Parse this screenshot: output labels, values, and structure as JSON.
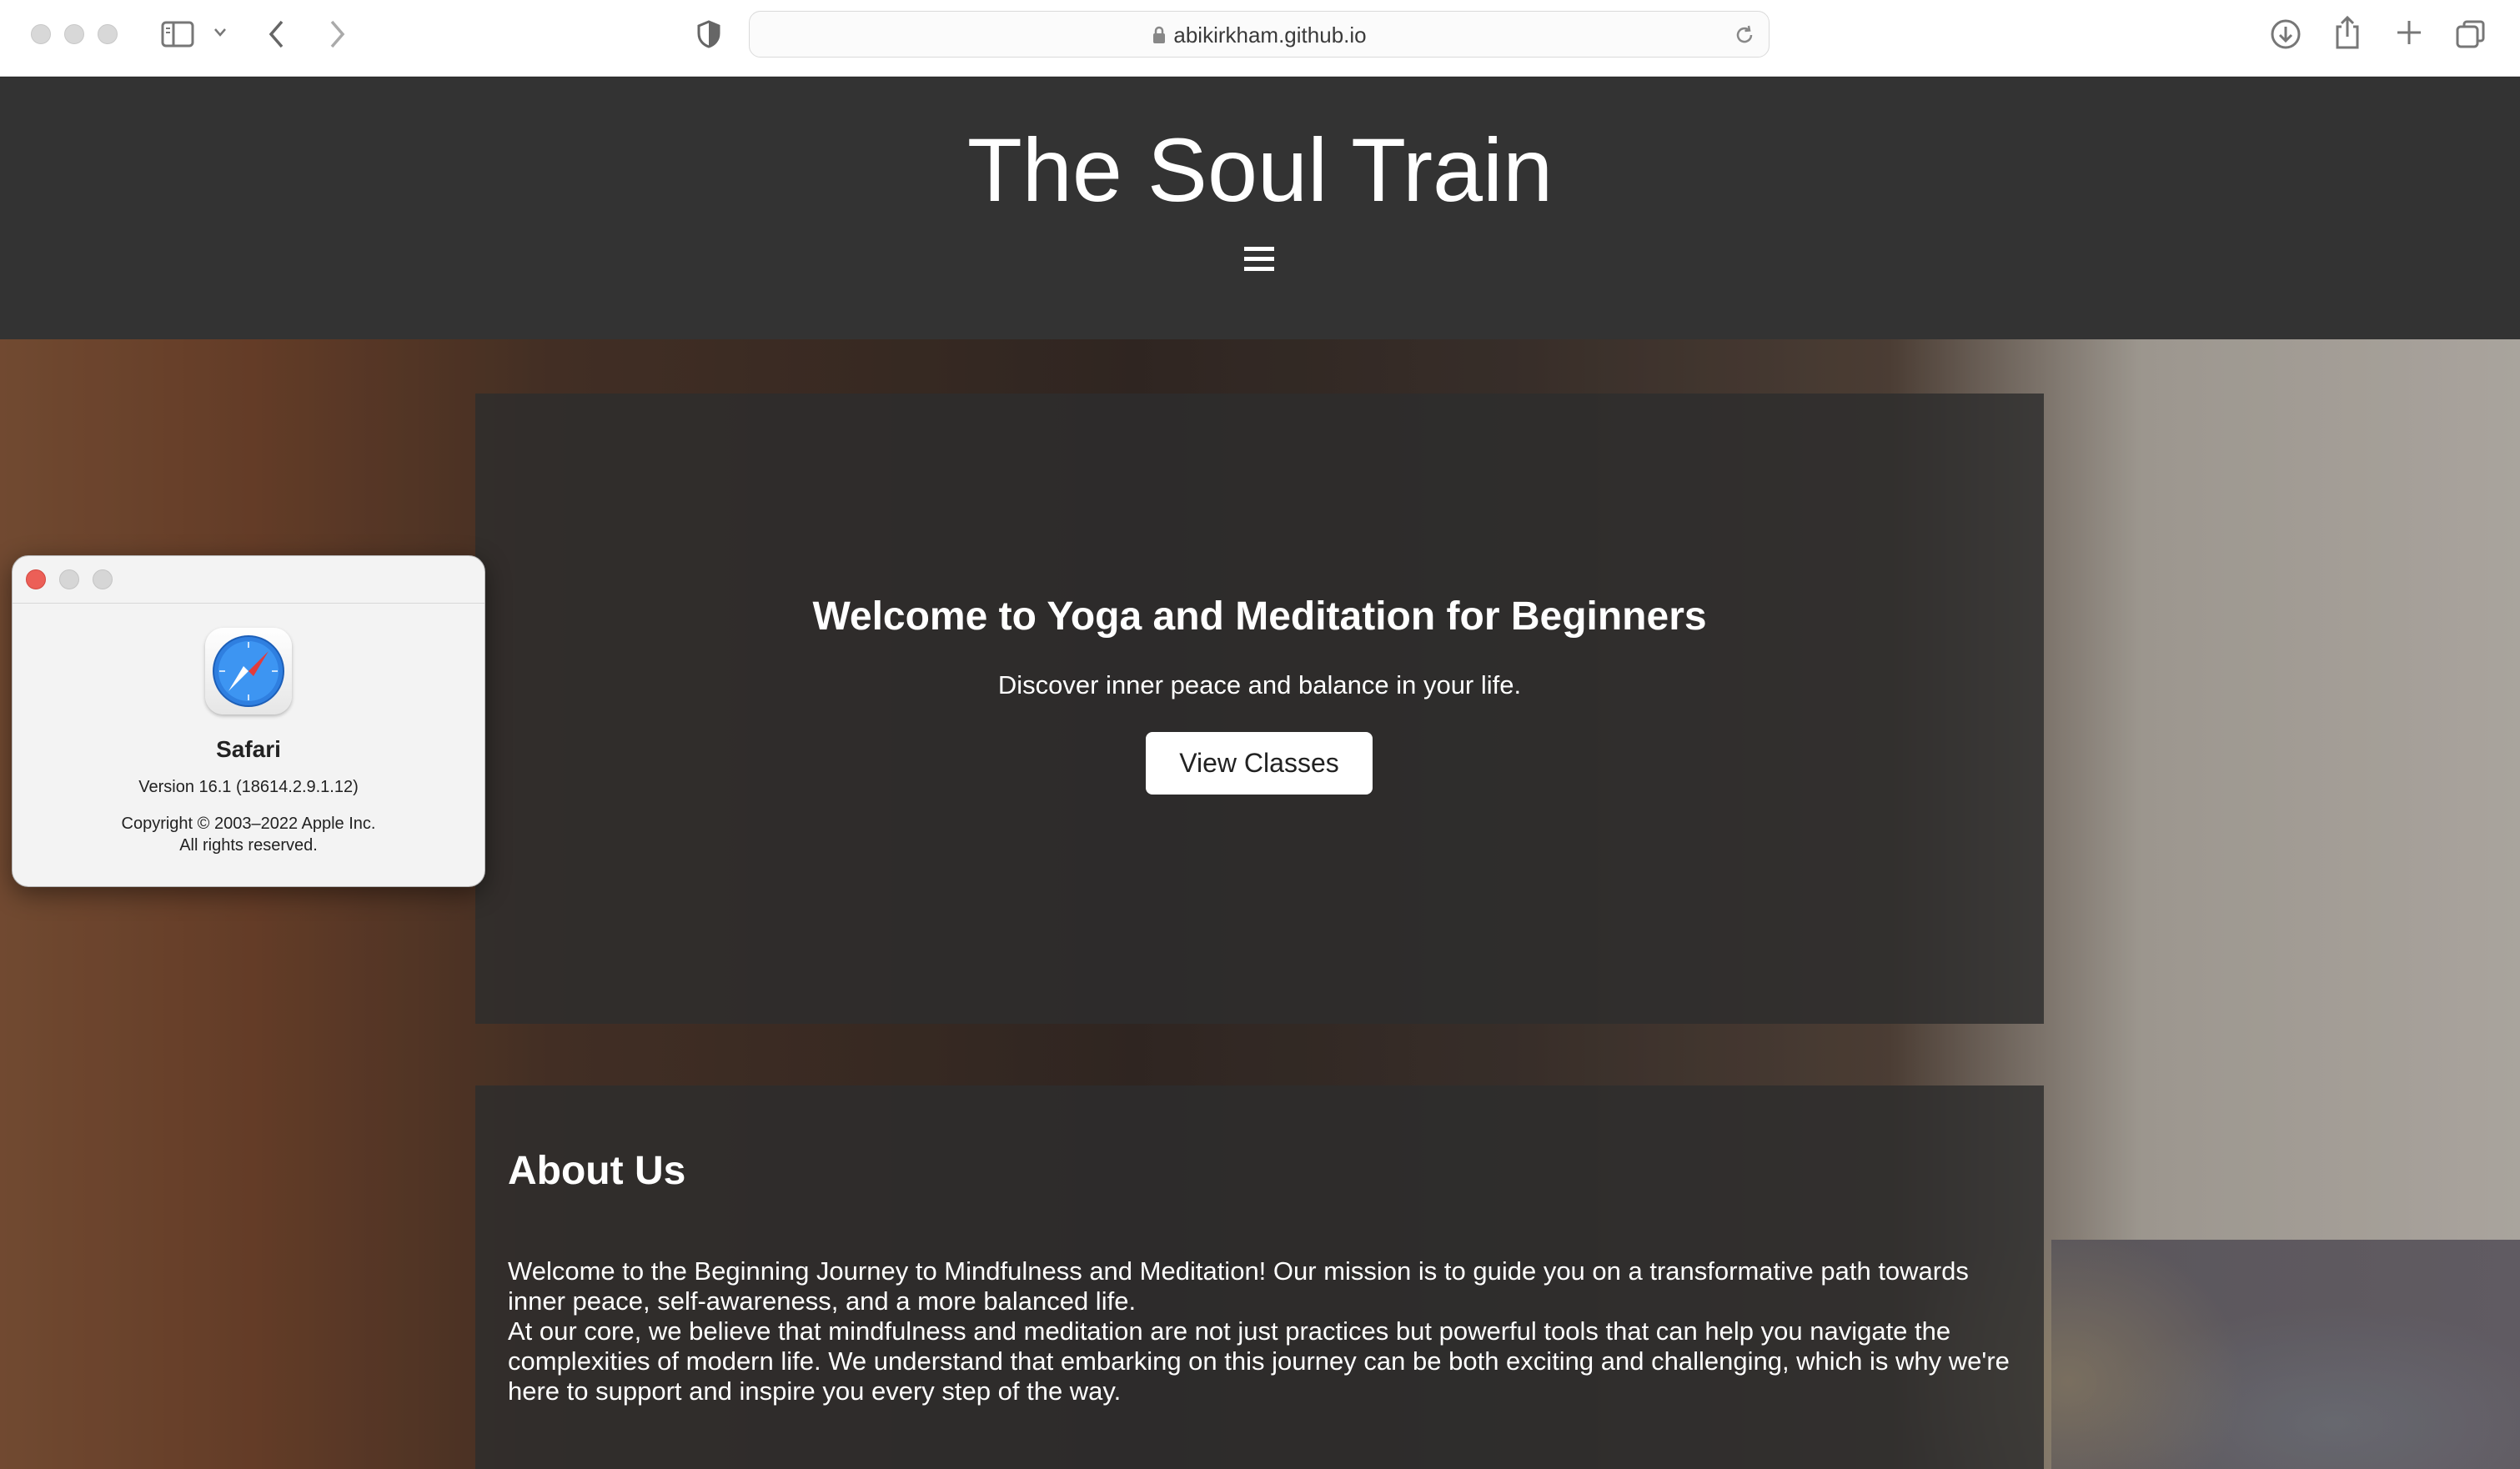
{
  "browser": {
    "url": "abikirkham.github.io"
  },
  "site": {
    "title": "The Soul Train"
  },
  "hero": {
    "heading": "Welcome to Yoga and Meditation for Beginners",
    "subheading": "Discover inner peace and balance in your life.",
    "button_label": "View Classes"
  },
  "about": {
    "heading": "About Us",
    "paragraph1": "Welcome to the Beginning Journey to Mindfulness and Meditation! Our mission is to guide you on a transformative path towards inner peace, self-awareness, and a more balanced life.",
    "paragraph2": "At our core, we believe that mindfulness and meditation are not just practices but powerful tools that can help you navigate the complexities of modern life. We understand that embarking on this journey can be both exciting and challenging, which is why we're here to support and inspire you every step of the way."
  },
  "about_safari_window": {
    "app_name": "Safari",
    "version": "Version 16.1 (18614.2.9.1.12)",
    "copyright": "Copyright © 2003–2022 Apple Inc.",
    "rights": "All rights reserved."
  },
  "colors": {
    "header_bg": "#333333",
    "panel_bg": "#2d2d2d",
    "close_red": "#ec5f57"
  }
}
